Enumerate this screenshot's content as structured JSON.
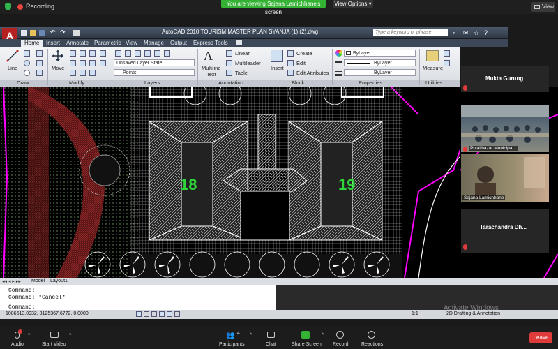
{
  "zoom": {
    "recording_label": "Recording",
    "viewing_banner": "You are viewing Sajana Lamichhane's screen",
    "view_options": "View Options",
    "view_button": "View",
    "toolbar": {
      "audio": "Audio",
      "start_video": "Start Video",
      "participants": "Participants",
      "participants_count": "4",
      "chat": "Chat",
      "share_screen": "Share Screen",
      "record": "Record",
      "reactions": "Reactions",
      "leave": "Leave"
    },
    "participants": [
      {
        "name": "Mukta Gurung"
      },
      {
        "name": "Putalibazar Municipa..."
      },
      {
        "name": "Sajana Lamichhane"
      },
      {
        "name": "Tarachandra  Dh..."
      }
    ],
    "colors": {
      "green": "#34b233",
      "red": "#e03b3b"
    }
  },
  "autocad": {
    "title": "AutoCAD 2010     TOURISM MASTER PLAN SYANJA (1) (2).dwg",
    "search_placeholder": "Type a keyword or phrase",
    "tabs": [
      "Home",
      "Insert",
      "Annotate",
      "Parametric",
      "View",
      "Manage",
      "Output",
      "Express Tools"
    ],
    "groups": [
      "Draw",
      "Modify",
      "Layers",
      "Annotation",
      "Block",
      "Properties",
      "Utilities"
    ],
    "tools": {
      "line": "Line",
      "move": "Move",
      "multiline_text_1": "Multiline",
      "multiline_text_2": "Text",
      "linear": "Linear",
      "multileader": "Multileader",
      "table": "Table",
      "insert": "Insert",
      "create": "Create",
      "edit": "Edit",
      "edit_attributes": "Edit Attributes",
      "measure": "Measure"
    },
    "layer_state": "Unsaved Layer State",
    "layer_points": "Points",
    "prop_color": "ByLayer",
    "prop_linetype": "ByLayer",
    "prop_lineweight": "ByLayer",
    "drawing_labels": [
      "18",
      "19"
    ],
    "sheet_tabs": [
      "Model",
      "Layout1"
    ],
    "command_lines": [
      "Command:",
      "Command: *Cancel*",
      "Command:"
    ],
    "coordinates": "1086613.0932, 3125367.6772, 0.0000",
    "scale": "1:1",
    "workspace": "2D Drafting & Annotation"
  },
  "watermark": "Activate Windows"
}
